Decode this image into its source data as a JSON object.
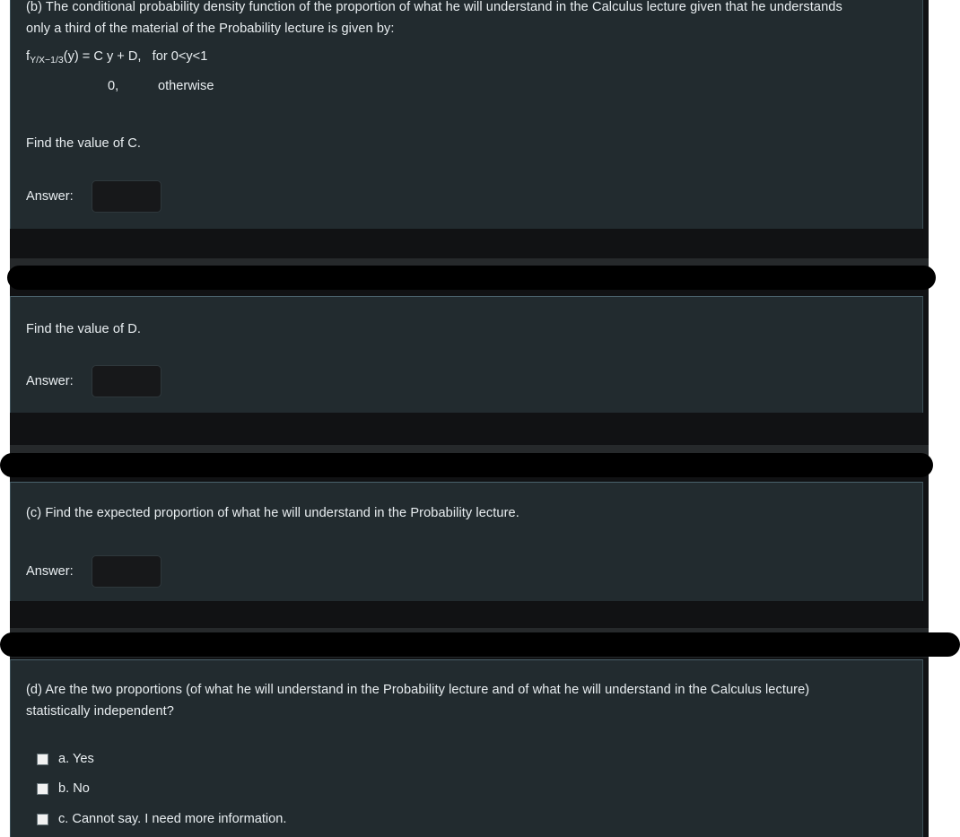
{
  "theme": {
    "panel_bg": "#222b2f",
    "page_bg": "#111214",
    "text_color": "#e9eef1",
    "input_bg": "#17181a",
    "border_color": "#3c5058",
    "redaction_color": "#000000",
    "checkbox_fill": "#f2f2f2"
  },
  "question_b": {
    "prompt_line1": "(b) The conditional probability density function of the proportion of what he will understand in the Calculus lecture given that he understands",
    "prompt_line2": "only a third of the material of the Probability lecture is given by:",
    "formula": {
      "fn_base": "f",
      "fn_subscript": "Y/X−1/3",
      "fn_arg": "(y) = C y + D,   for 0<y<1",
      "case_zero": "0,",
      "case_otherwise": "otherwise"
    },
    "find_c_text": "Find the value of C.",
    "answer_label": "Answer:",
    "answer_value": "",
    "answer_placeholder": ""
  },
  "question_b2": {
    "find_d_text": "Find the value of D.",
    "answer_label": "Answer:",
    "answer_value": "",
    "answer_placeholder": ""
  },
  "question_c": {
    "prompt": "(c) Find the expected proportion of what he will understand in the Probability lecture.",
    "answer_label": "Answer:",
    "answer_value": "",
    "answer_placeholder": ""
  },
  "question_d": {
    "prompt_line1": "(d) Are the two proportions (of what he will understand in the Probability lecture and of what he will understand in the Calculus lecture)",
    "prompt_line2": "statistically independent?",
    "options": [
      {
        "label": "a. Yes",
        "checked": false
      },
      {
        "label": "b. No",
        "checked": false
      },
      {
        "label": "c. Cannot say. I need more information.",
        "checked": false
      }
    ]
  },
  "redactions": [
    {
      "name": "redaction-bar-1",
      "note": "black bar over feedback area after question b part C"
    },
    {
      "name": "redaction-bar-2",
      "note": "black bar over feedback area after question b part D"
    },
    {
      "name": "redaction-bar-3",
      "note": "black bar over feedback area after question c"
    }
  ]
}
